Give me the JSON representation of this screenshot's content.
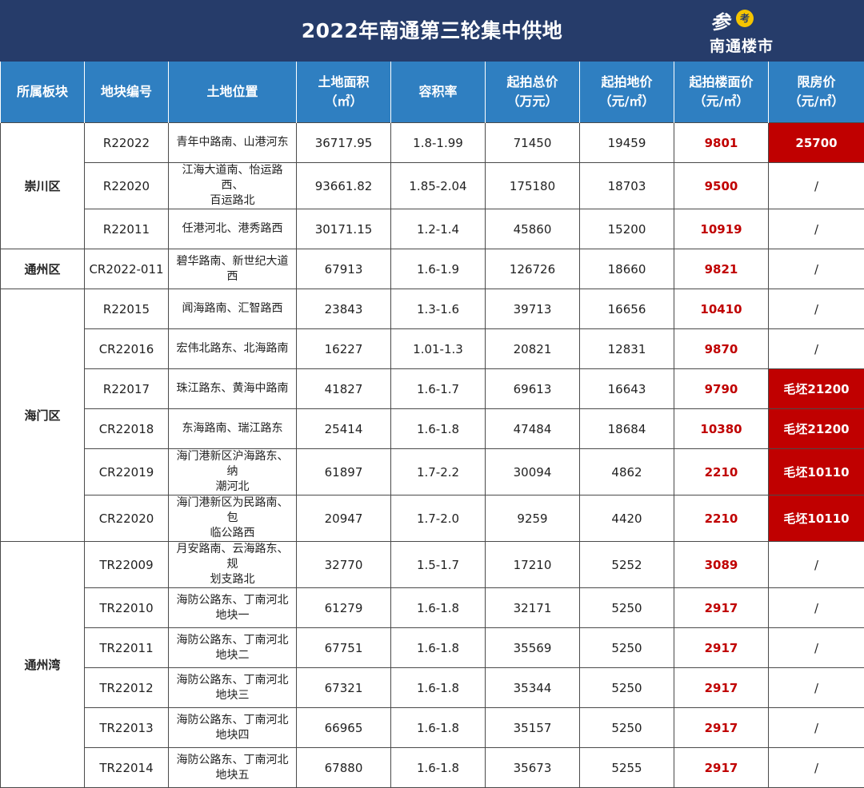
{
  "title": "2022年南通第三轮集中供地",
  "logo": {
    "glyph": "参",
    "badge": "考",
    "name": "南通楼市"
  },
  "colors": {
    "banner_bg": "#263c6a",
    "header_bg": "#2f7fc1",
    "highlight_red": "#c00000",
    "floor_price_text": "#c00000"
  },
  "columns": [
    [
      "所属板块"
    ],
    [
      "地块编号"
    ],
    [
      "土地位置"
    ],
    [
      "土地面积",
      "（㎡）"
    ],
    [
      "容积率"
    ],
    [
      "起拍总价",
      "（万元）"
    ],
    [
      "起拍地价",
      "（元/㎡）"
    ],
    [
      "起拍楼面价",
      "（元/㎡）"
    ],
    [
      "限房价",
      "（元/㎡）"
    ]
  ],
  "groups": [
    {
      "district": "崇川区",
      "rows": [
        {
          "code": "R22022",
          "location": [
            "青年中路南、山港河东"
          ],
          "area": "36717.95",
          "far": "1.8-1.99",
          "total": "71450",
          "land_price": "19459",
          "floor_price": "9801",
          "limit_price": "25700",
          "limit_highlight": true
        },
        {
          "code": "R22020",
          "location": [
            "江海大道南、怡运路西、",
            "百运路北"
          ],
          "area": "93661.82",
          "far": "1.85-2.04",
          "total": "175180",
          "land_price": "18703",
          "floor_price": "9500",
          "limit_price": "/",
          "limit_highlight": false
        },
        {
          "code": "R22011",
          "location": [
            "任港河北、港秀路西"
          ],
          "area": "30171.15",
          "far": "1.2-1.4",
          "total": "45860",
          "land_price": "15200",
          "floor_price": "10919",
          "limit_price": "/",
          "limit_highlight": false
        }
      ]
    },
    {
      "district": "通州区",
      "rows": [
        {
          "code": "CR2022-011",
          "location": [
            "碧华路南、新世纪大道西"
          ],
          "area": "67913",
          "far": "1.6-1.9",
          "total": "126726",
          "land_price": "18660",
          "floor_price": "9821",
          "limit_price": "/",
          "limit_highlight": false
        }
      ]
    },
    {
      "district": "海门区",
      "rows": [
        {
          "code": "R22015",
          "location": [
            "闻海路南、汇智路西"
          ],
          "area": "23843",
          "far": "1.3-1.6",
          "total": "39713",
          "land_price": "16656",
          "floor_price": "10410",
          "limit_price": "/",
          "limit_highlight": false
        },
        {
          "code": "CR22016",
          "location": [
            "宏伟北路东、北海路南"
          ],
          "area": "16227",
          "far": "1.01-1.3",
          "total": "20821",
          "land_price": "12831",
          "floor_price": "9870",
          "limit_price": "/",
          "limit_highlight": false
        },
        {
          "code": "R22017",
          "location": [
            "珠江路东、黄海中路南"
          ],
          "area": "41827",
          "far": "1.6-1.7",
          "total": "69613",
          "land_price": "16643",
          "floor_price": "9790",
          "limit_price": "毛坯21200",
          "limit_highlight": true
        },
        {
          "code": "CR22018",
          "location": [
            "东海路南、瑞江路东"
          ],
          "area": "25414",
          "far": "1.6-1.8",
          "total": "47484",
          "land_price": "18684",
          "floor_price": "10380",
          "limit_price": "毛坯21200",
          "limit_highlight": true
        },
        {
          "code": "CR22019",
          "location": [
            "海门港新区沪海路东、纳",
            "潮河北"
          ],
          "area": "61897",
          "far": "1.7-2.2",
          "total": "30094",
          "land_price": "4862",
          "floor_price": "2210",
          "limit_price": "毛坯10110",
          "limit_highlight": true
        },
        {
          "code": "CR22020",
          "location": [
            "海门港新区为民路南、包",
            "临公路西"
          ],
          "area": "20947",
          "far": "1.7-2.0",
          "total": "9259",
          "land_price": "4420",
          "floor_price": "2210",
          "limit_price": "毛坯10110",
          "limit_highlight": true
        }
      ]
    },
    {
      "district": "通州湾",
      "rows": [
        {
          "code": "TR22009",
          "location": [
            "月安路南、云海路东、规",
            "划支路北"
          ],
          "area": "32770",
          "far": "1.5-1.7",
          "total": "17210",
          "land_price": "5252",
          "floor_price": "3089",
          "limit_price": "/",
          "limit_highlight": false
        },
        {
          "code": "TR22010",
          "location": [
            "海防公路东、丁南河北",
            "地块一"
          ],
          "area": "61279",
          "far": "1.6-1.8",
          "total": "32171",
          "land_price": "5250",
          "floor_price": "2917",
          "limit_price": "/",
          "limit_highlight": false
        },
        {
          "code": "TR22011",
          "location": [
            "海防公路东、丁南河北",
            "地块二"
          ],
          "area": "67751",
          "far": "1.6-1.8",
          "total": "35569",
          "land_price": "5250",
          "floor_price": "2917",
          "limit_price": "/",
          "limit_highlight": false
        },
        {
          "code": "TR22012",
          "location": [
            "海防公路东、丁南河北",
            "地块三"
          ],
          "area": "67321",
          "far": "1.6-1.8",
          "total": "35344",
          "land_price": "5250",
          "floor_price": "2917",
          "limit_price": "/",
          "limit_highlight": false
        },
        {
          "code": "TR22013",
          "location": [
            "海防公路东、丁南河北",
            "地块四"
          ],
          "area": "66965",
          "far": "1.6-1.8",
          "total": "35157",
          "land_price": "5250",
          "floor_price": "2917",
          "limit_price": "/",
          "limit_highlight": false
        },
        {
          "code": "TR22014",
          "location": [
            "海防公路东、丁南河北",
            "地块五"
          ],
          "area": "67880",
          "far": "1.6-1.8",
          "total": "35673",
          "land_price": "5255",
          "floor_price": "2917",
          "limit_price": "/",
          "limit_highlight": false
        }
      ]
    }
  ]
}
